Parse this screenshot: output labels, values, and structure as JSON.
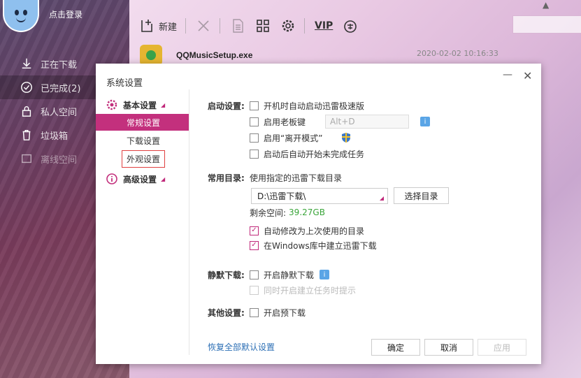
{
  "app": {
    "login_label": "点击登录",
    "sidebar": [
      {
        "label": "正在下载",
        "icon": "download-icon"
      },
      {
        "label": "已完成(2)",
        "icon": "check-circle-icon"
      },
      {
        "label": "私人空间",
        "icon": "lock-icon"
      },
      {
        "label": "垃圾箱",
        "icon": "trash-icon"
      },
      {
        "label": "离线空间",
        "icon": "cloud-icon"
      }
    ],
    "toolbar": {
      "new_label": "新建",
      "vip_label": "VIP"
    },
    "file": {
      "name": "QQMusicSetup.exe",
      "time": "2020-02-02 10:16:33"
    }
  },
  "dialog": {
    "title": "系统设置",
    "nav": {
      "basic_group": "基本设置",
      "items": [
        "常规设置",
        "下载设置",
        "外观设置"
      ],
      "advanced_group": "高级设置"
    },
    "startup": {
      "label": "启动设置:",
      "opt_autostart": "开机时自动启动迅雷极速版",
      "opt_boss_key": "启用老板键",
      "boss_key_value": "Alt+D",
      "opt_away_mode": "启用“离开模式”",
      "opt_resume": "启动后自动开始未完成任务"
    },
    "dir": {
      "label": "常用目录:",
      "desc": "使用指定的迅雷下载目录",
      "path": "D:\\迅雷下载\\",
      "choose_btn": "选择目录",
      "free_label": "剩余空间:",
      "free_value": "39.27GB",
      "opt_last_dir": "自动修改为上次使用的目录",
      "opt_windows_lib": "在Windows库中建立迅雷下载"
    },
    "silent": {
      "label": "静默下载:",
      "opt_enable": "开启静默下载",
      "opt_prompt": "同时开启建立任务时提示"
    },
    "other": {
      "label": "其他设置:",
      "opt_predownload": "开启预下载"
    },
    "footer": {
      "restore_link": "恢复全部默认设置",
      "ok": "确定",
      "cancel": "取消",
      "apply": "应用"
    }
  },
  "colors": {
    "accent": "#c3307d",
    "free_space": "#3aa53a",
    "link": "#2c6fb5"
  }
}
